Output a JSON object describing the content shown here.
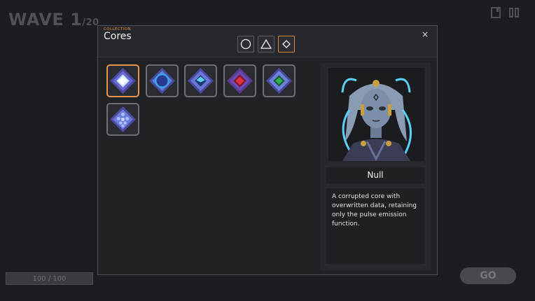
{
  "hud": {
    "wave_label": "WAVE",
    "wave_number": "1",
    "wave_total": "/20",
    "hp_text": "100 / 100",
    "go_label": "GO"
  },
  "modal": {
    "eyebrow": "COLLECTION",
    "title": "Cores",
    "close_symbol": "×",
    "filters": [
      {
        "icon": "circle-icon",
        "active": false
      },
      {
        "icon": "triangle-icon",
        "active": false
      },
      {
        "icon": "diamond-icon",
        "active": true
      }
    ],
    "cores": [
      {
        "icon": "white-core-icon",
        "color": "#c8e8ff",
        "selected": true
      },
      {
        "icon": "blue-ring-core-icon",
        "color": "#3f7fe0",
        "selected": false
      },
      {
        "icon": "cyan-core-icon",
        "color": "#5cd0f0",
        "selected": false
      },
      {
        "icon": "red-core-icon",
        "color": "#d0303c",
        "selected": false
      },
      {
        "icon": "green-core-icon",
        "color": "#30a050",
        "selected": false
      },
      {
        "icon": "cluster-core-icon",
        "color": "#7a9af0",
        "selected": false
      }
    ],
    "detail": {
      "name": "Null",
      "description": "A corrupted core with overwritten data, retaining only the pulse emission function."
    }
  },
  "colors": {
    "accent": "#e0873e",
    "background": "#1c1d22",
    "panel": "#212226"
  }
}
